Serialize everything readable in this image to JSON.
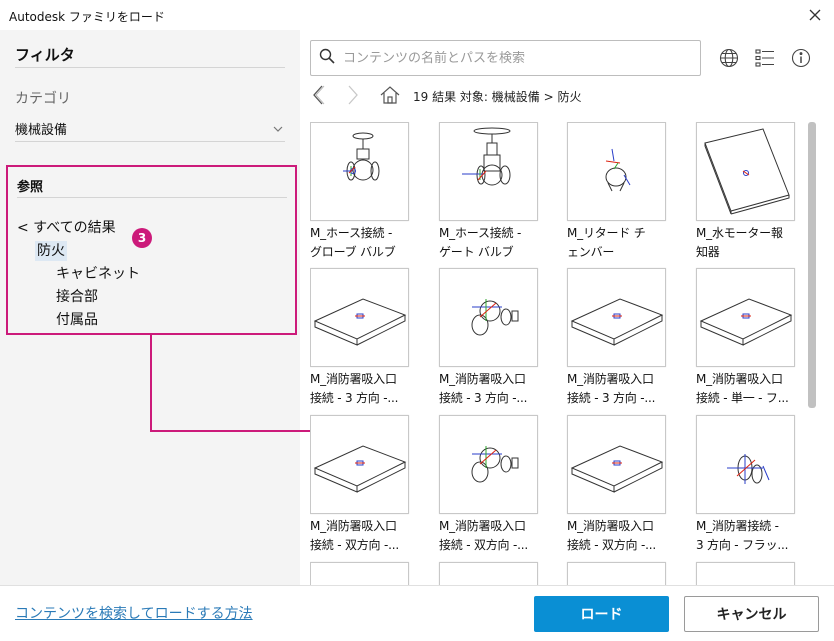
{
  "window": {
    "title": "Autodesk ファミリをロード",
    "close_icon": "close-icon"
  },
  "sidebar": {
    "title": "フィルタ",
    "category_label": "カテゴリ",
    "category_value": "機械設備",
    "reference": {
      "title": "参照",
      "tree": [
        {
          "label": "< すべての結果",
          "level": 0,
          "selected": false
        },
        {
          "label": "防火",
          "level": 1,
          "selected": true
        },
        {
          "label": "キャビネット",
          "level": 2,
          "selected": false
        },
        {
          "label": "接合部",
          "level": 2,
          "selected": false
        },
        {
          "label": "付属品",
          "level": 2,
          "selected": false
        }
      ]
    },
    "badge": "3"
  },
  "search": {
    "placeholder": "コンテンツの名前とパスを検索",
    "value": ""
  },
  "breadcrumb": "19 結果  対象:  機械設備 > 防火",
  "items": [
    {
      "line1": "M_ホース接続 -",
      "line2": "グローブ バルブ",
      "thumb": "valve-globe"
    },
    {
      "line1": "M_ホース接続 -",
      "line2": "ゲート バルブ",
      "thumb": "valve-gate"
    },
    {
      "line1": "M_リタード チ",
      "line2": "ェンバー",
      "thumb": "chamber"
    },
    {
      "line1": "M_水モーター報",
      "line2": "知器",
      "thumb": "plate-rotated"
    },
    {
      "line1": "M_消防署吸入口",
      "line2": "接続 - 3 方向 -...",
      "thumb": "plate"
    },
    {
      "line1": "M_消防署吸入口",
      "line2": "接続 - 3 方向 -...",
      "thumb": "fitting"
    },
    {
      "line1": "M_消防署吸入口",
      "line2": "接続 - 3 方向 -...",
      "thumb": "plate"
    },
    {
      "line1": "M_消防署吸入口",
      "line2": "接続 - 単一 - フ...",
      "thumb": "plate"
    },
    {
      "line1": "M_消防署吸入口",
      "line2": "接続 - 双方向 -...",
      "thumb": "plate"
    },
    {
      "line1": "M_消防署吸入口",
      "line2": "接続 - 双方向 -...",
      "thumb": "fitting"
    },
    {
      "line1": "M_消防署吸入口",
      "line2": "接続 - 双方向 -...",
      "thumb": "plate"
    },
    {
      "line1": "M_消防署接続 -",
      "line2": "3 方向 - フラッ...",
      "thumb": "fitting-small"
    },
    {
      "line1": "",
      "line2": "",
      "thumb": "empty"
    },
    {
      "line1": "",
      "line2": "",
      "thumb": "empty"
    },
    {
      "line1": "",
      "line2": "",
      "thumb": "empty"
    },
    {
      "line1": "",
      "line2": "",
      "thumb": "empty"
    }
  ],
  "footer": {
    "help_link": "コンテンツを検索してロードする方法",
    "load_label": "ロード",
    "cancel_label": "キャンセル"
  },
  "colors": {
    "accent": "#0a8fd4",
    "annotation": "#cc1a7a",
    "link": "#2a7ab7"
  }
}
